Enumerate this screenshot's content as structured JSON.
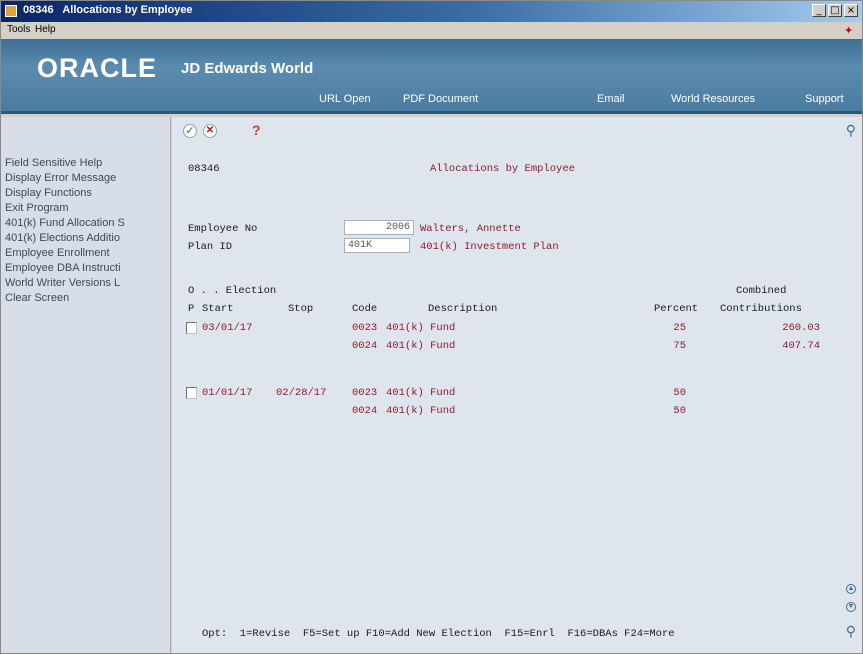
{
  "window": {
    "title": "08346   Allocations by Employee",
    "min": "_",
    "max": "□",
    "close": "×"
  },
  "menubar": {
    "tools": "Tools",
    "help": "Help"
  },
  "header": {
    "brand": "ORACLE",
    "product": "JD Edwards World",
    "links": [
      "URL Open",
      "PDF Document",
      "Email",
      "World Resources",
      "Support"
    ]
  },
  "sidebar": {
    "items": [
      "Field Sensitive Help",
      "Display Error Message",
      "Display Functions",
      "Exit Program",
      "401(k) Fund Allocation S",
      "401(k) Elections Additio",
      "Employee Enrollment",
      "Employee DBA Instructi",
      "World Writer Versions L",
      "Clear Screen"
    ]
  },
  "toolbar": {
    "ok": "✓",
    "cancel": "✕",
    "help": "?"
  },
  "form": {
    "program_id": "08346",
    "screen_title": "Allocations by Employee",
    "employee_no_label": "Employee No",
    "employee_no_value": "2006",
    "employee_name": "Walters, Annette",
    "plan_id_label": "Plan ID",
    "plan_id_value": "401K",
    "plan_name": "401(k) Investment Plan"
  },
  "grid": {
    "header1_left": "O . . Election",
    "header1_right": "Combined",
    "columns": {
      "p": "P",
      "start": "Start",
      "stop": "Stop",
      "code": "Code",
      "description": "Description",
      "percent": "Percent",
      "contributions": "Contributions"
    },
    "groups": [
      {
        "start": "03/01/17",
        "stop": "",
        "lines": [
          {
            "code": "0023",
            "description": "401(k) Fund",
            "percent": "25",
            "contributions": "260.03"
          },
          {
            "code": "0024",
            "description": "401(k) Fund",
            "percent": "75",
            "contributions": "407.74"
          }
        ]
      },
      {
        "start": "01/01/17",
        "stop": "02/28/17",
        "lines": [
          {
            "code": "0023",
            "description": "401(k) Fund",
            "percent": "50",
            "contributions": ""
          },
          {
            "code": "0024",
            "description": "401(k) Fund",
            "percent": "50",
            "contributions": ""
          }
        ]
      }
    ]
  },
  "footer": {
    "options": "Opt:  1=Revise  F5=Set up F10=Add New Election  F15=Enrl  F16=DBAs F24=More"
  },
  "colors": {
    "header_blue": "#4a7ba0",
    "data_red": "#8b1c2c",
    "screen_bg": "#dfe5ec",
    "sidebar_bg": "#d7dee7"
  }
}
